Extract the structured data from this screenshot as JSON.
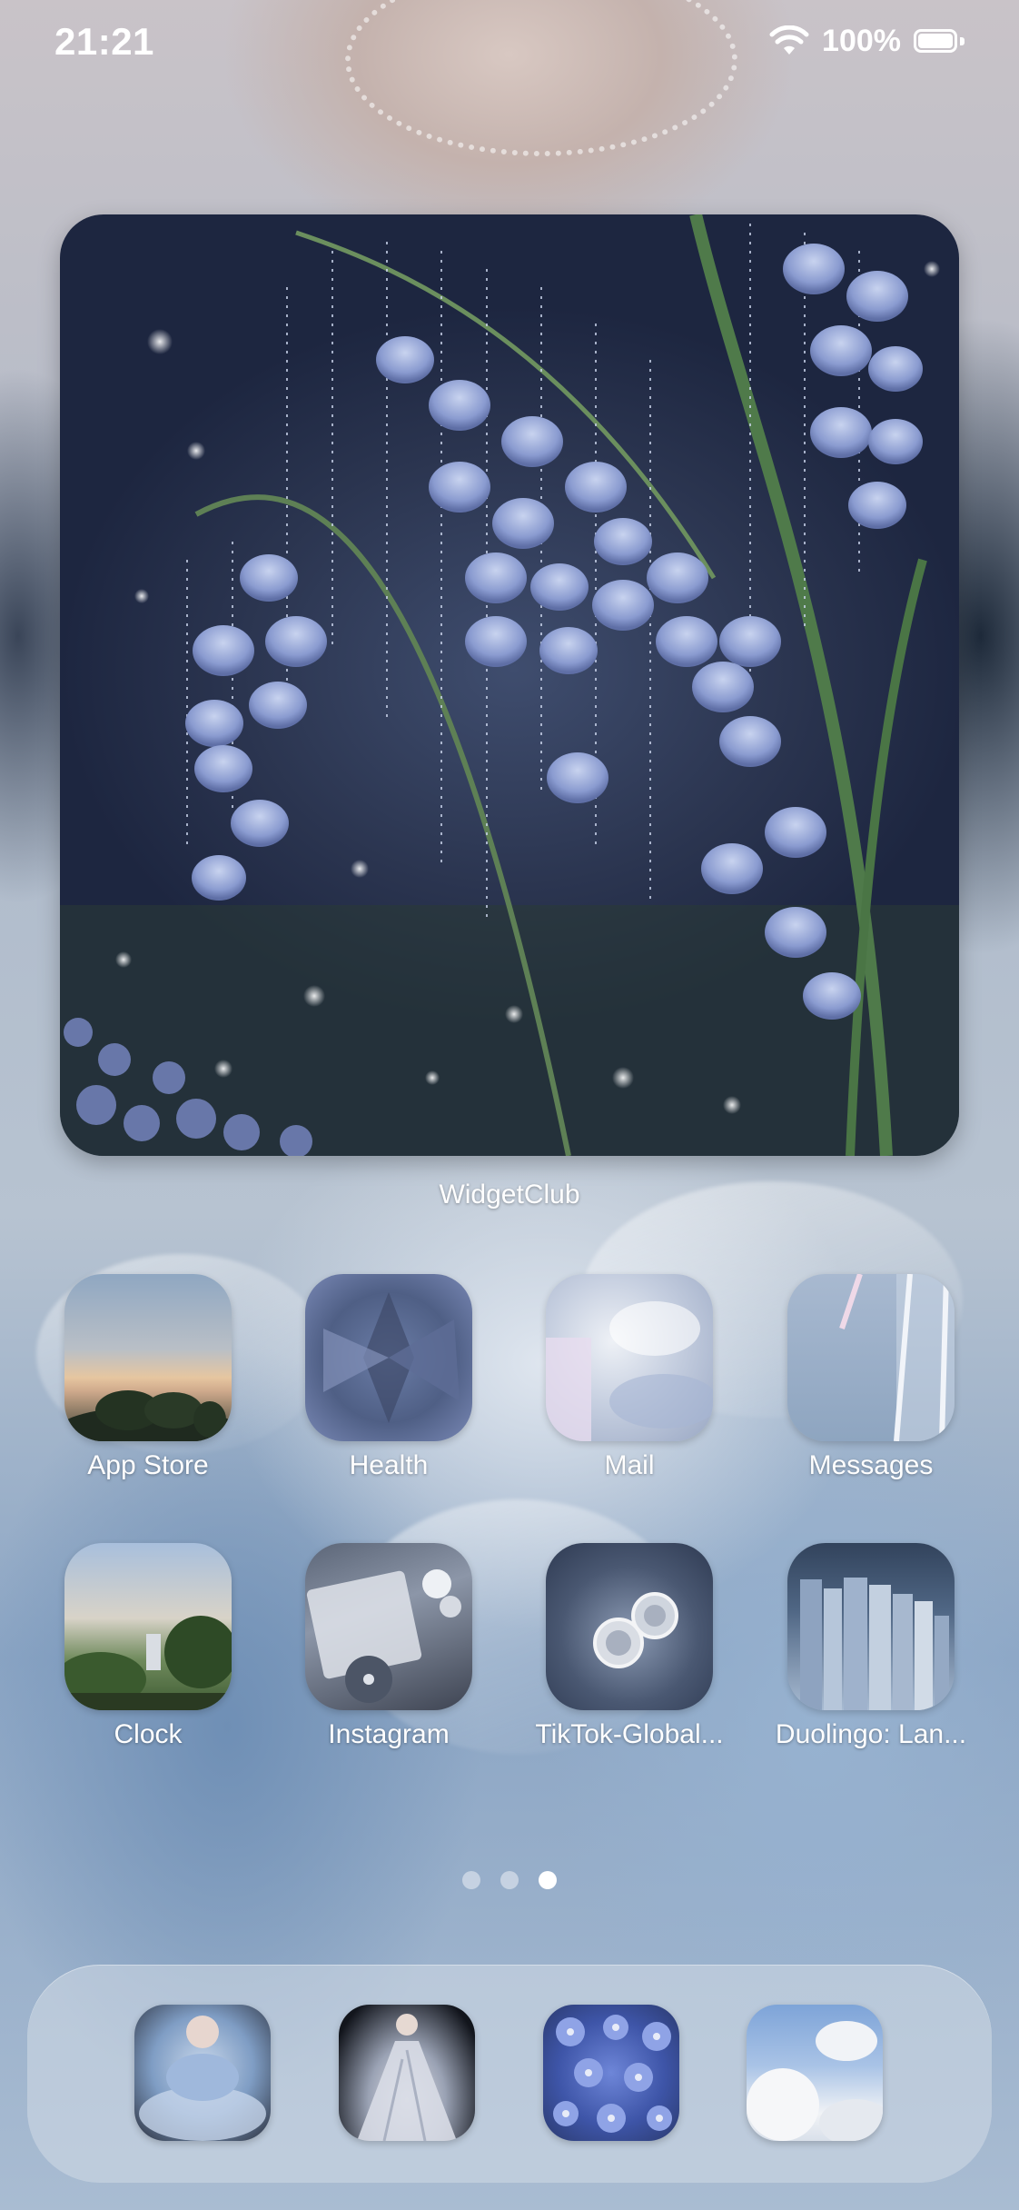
{
  "status_bar": {
    "time": "21:21",
    "battery_percent": "100%",
    "icons": [
      "wifi-icon",
      "battery-icon"
    ]
  },
  "widget": {
    "caption": "WidgetClub",
    "image": "lily-of-the-valley-photo"
  },
  "apps": [
    {
      "label": "App Store",
      "icon": "app-store-icon"
    },
    {
      "label": "Health",
      "icon": "health-icon"
    },
    {
      "label": "Mail",
      "icon": "mail-icon"
    },
    {
      "label": "Messages",
      "icon": "messages-icon"
    },
    {
      "label": "Clock",
      "icon": "clock-icon"
    },
    {
      "label": "Instagram",
      "icon": "instagram-icon"
    },
    {
      "label": "TikTok-Global...",
      "icon": "tiktok-icon"
    },
    {
      "label": "Duolingo: Lan...",
      "icon": "duolingo-icon"
    }
  ],
  "page_indicator": {
    "count": 3,
    "active": 3
  },
  "dock": {
    "items": [
      "dock-app-1-icon",
      "dock-app-2-icon",
      "dock-app-3-icon",
      "dock-app-4-icon"
    ]
  },
  "colors": {
    "text": "#ffffff",
    "dock_background": "#d2dae6"
  }
}
